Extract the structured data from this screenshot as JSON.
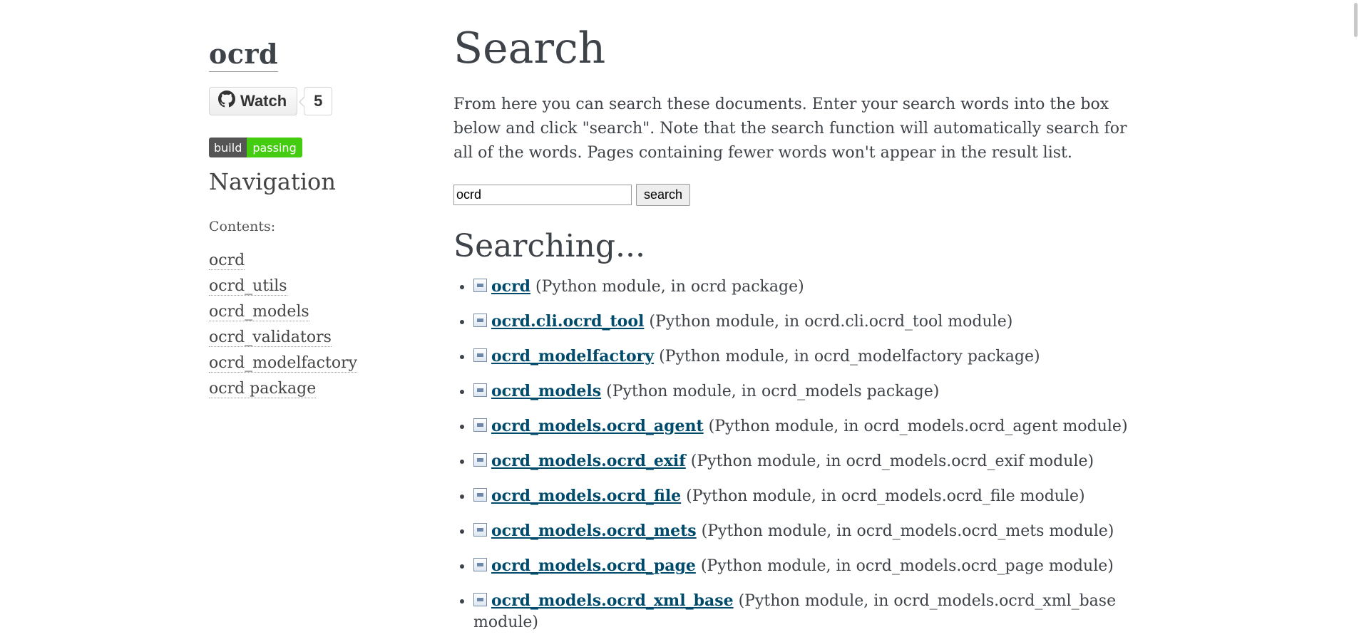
{
  "sidebar": {
    "logo": "ocrd",
    "github": {
      "watch_label": "Watch",
      "watch_count": "5"
    },
    "badge": {
      "left": "build",
      "right": "passing"
    },
    "nav_title": "Navigation",
    "contents_label": "Contents:",
    "items": [
      {
        "label": "ocrd"
      },
      {
        "label": "ocrd_utils"
      },
      {
        "label": "ocrd_models"
      },
      {
        "label": "ocrd_validators"
      },
      {
        "label": "ocrd_modelfactory"
      },
      {
        "label": "ocrd package"
      }
    ]
  },
  "main": {
    "title": "Search",
    "intro": "From here you can search these documents. Enter your search words into the box below and click \"search\". Note that the search function will automatically search for all of the words. Pages containing fewer words won't appear in the result list.",
    "search": {
      "value": "ocrd",
      "button_label": "search"
    },
    "searching_heading": "Searching...",
    "results": [
      {
        "link": "ocrd",
        "desc": "(Python module, in ocrd package)"
      },
      {
        "link": "ocrd.cli.ocrd_tool",
        "desc": "(Python module, in ocrd.cli.ocrd_tool module)"
      },
      {
        "link": "ocrd_modelfactory",
        "desc": "(Python module, in ocrd_modelfactory package)"
      },
      {
        "link": "ocrd_models",
        "desc": "(Python module, in ocrd_models package)"
      },
      {
        "link": "ocrd_models.ocrd_agent",
        "desc": "(Python module, in ocrd_models.ocrd_agent module)"
      },
      {
        "link": "ocrd_models.ocrd_exif",
        "desc": "(Python module, in ocrd_models.ocrd_exif module)"
      },
      {
        "link": "ocrd_models.ocrd_file",
        "desc": "(Python module, in ocrd_models.ocrd_file module)"
      },
      {
        "link": "ocrd_models.ocrd_mets",
        "desc": "(Python module, in ocrd_models.ocrd_mets module)"
      },
      {
        "link": "ocrd_models.ocrd_page",
        "desc": "(Python module, in ocrd_models.ocrd_page module)"
      },
      {
        "link": "ocrd_models.ocrd_xml_base",
        "desc": "(Python module, in ocrd_models.ocrd_xml_base module)"
      }
    ]
  },
  "colors": {
    "link": "#004b6b",
    "text": "#3e4349",
    "badge_left": "#555555",
    "badge_right": "#44cc11"
  }
}
